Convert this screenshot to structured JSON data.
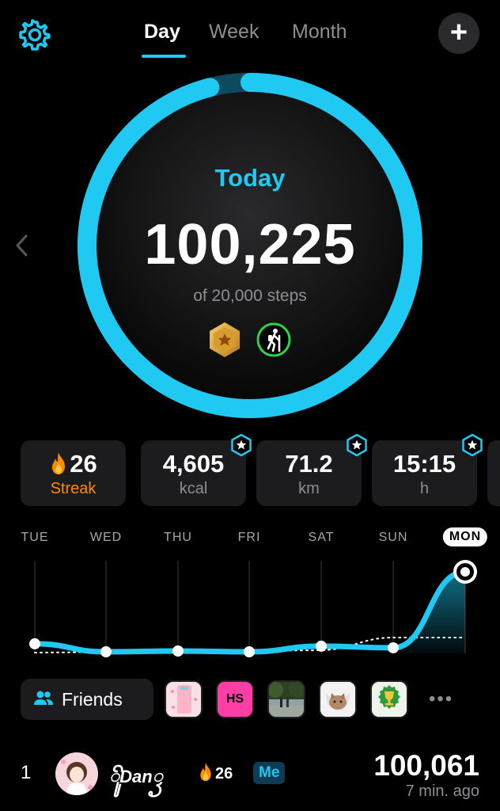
{
  "header": {
    "tabs": [
      {
        "label": "Day",
        "active": true
      },
      {
        "label": "Week",
        "active": false
      },
      {
        "label": "Month",
        "active": false
      }
    ],
    "add_label": "+"
  },
  "ring": {
    "title": "Today",
    "steps": "100,225",
    "goal_text": "of 20,000 steps",
    "progress_fraction": 0.96
  },
  "stats": [
    {
      "value": "26",
      "label": "Streak",
      "icon": "flame-icon"
    },
    {
      "value": "4,605",
      "label": "kcal"
    },
    {
      "value": "71.2",
      "label": "km"
    },
    {
      "value": "15:15",
      "label": "h"
    }
  ],
  "chart_data": {
    "type": "line",
    "categories": [
      "TUE",
      "WED",
      "THU",
      "FRI",
      "SAT",
      "SUN",
      "MON"
    ],
    "series": [
      {
        "values": [
          10,
          0,
          1,
          0,
          7,
          5,
          100
        ]
      }
    ],
    "active_category": "MON",
    "grid": true
  },
  "friends": {
    "label": "Friends",
    "favorites": [
      {
        "type": "image",
        "icon": "pink-pattern"
      },
      {
        "type": "text",
        "text": "HS"
      },
      {
        "type": "image",
        "icon": "outdoor-photo"
      },
      {
        "type": "image",
        "icon": "cat-photo"
      },
      {
        "type": "image",
        "icon": "trophy-icon"
      }
    ],
    "more_label": "•••"
  },
  "leaderboard": {
    "rank": "1",
    "name": "ꦼꦸDanꦽ",
    "streak": "26",
    "me_label": "Me",
    "steps": "100,061",
    "time": "7 min. ago"
  },
  "colors": {
    "accent": "#1fc9f2",
    "streak_orange": "#ff8a00",
    "card_bg": "#1c1c1e"
  }
}
